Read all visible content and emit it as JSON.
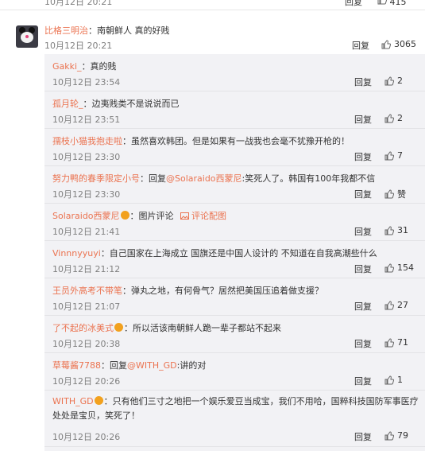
{
  "top": {
    "time": "10月12日 20:21",
    "reply": "回复",
    "likes": "415"
  },
  "main": {
    "user": "比格三明治",
    "text": "：南朝鲜人 真的好贱",
    "time": "10月12日 20:21",
    "reply": "回复",
    "likes": "3065"
  },
  "replies": [
    {
      "user": "Gakki_",
      "text": "：真的贱",
      "time": "10月12日 23:54",
      "reply": "回复",
      "likes": "2"
    },
    {
      "user": "孤月轮_",
      "text": "：边夷贱类不是说说而已",
      "time": "10月12日 23:51",
      "reply": "回复",
      "likes": "2"
    },
    {
      "user": "孺枝小猫我抱走啦",
      "text": "：虽然喜欢韩团。但是如果有一战我也会毫不犹豫开枪的！",
      "time": "10月12日 23:30",
      "reply": "回复",
      "likes": "7"
    },
    {
      "user": "努力鸭的春季限定小号",
      "text_pre": "：回复",
      "mention": "@Solaraido西蒙尼",
      "text": ":笑死人了。韩国有100年我都不信",
      "time": "10月12日 23:30",
      "reply": "回复",
      "likes": "赞"
    },
    {
      "user": "Solaraido西蒙尼",
      "text": "：图片评论",
      "piclink": "评论配图",
      "time": "10月12日 21:41",
      "reply": "回复",
      "likes": "31"
    },
    {
      "user": "Vinnnyyuyi",
      "text": "：自己国家在上海成立 国旗还是中国人设计的 不知道在自我高潮些什么",
      "time": "10月12日 21:12",
      "reply": "回复",
      "likes": "154"
    },
    {
      "user": "王员外高考不带笔",
      "text": "：弹丸之地，有何骨气？居然把美国压追着做支援？",
      "time": "10月12日 21:07",
      "reply": "回复",
      "likes": "27"
    },
    {
      "user": "了不起的冰美式",
      "text": "：所以活该南朝鲜人跪一辈子都站不起来",
      "time": "10月12日 20:38",
      "reply": "回复",
      "likes": "71"
    },
    {
      "user": "草莓酱7788",
      "text_pre": "：回复",
      "mention": "@WITH_GD",
      "text": ":讲的对",
      "time": "10月12日 20:26",
      "reply": "回复",
      "likes": "1"
    },
    {
      "user": "WITH_GD",
      "text": "：只有他们三寸之地把一个娱乐爱豆当成宝，我们不用哈，国粹科技国防军事医疗处处是宝贝，笑死了！",
      "time": "10月12日 20:26",
      "reply": "回复",
      "likes": "79"
    }
  ]
}
